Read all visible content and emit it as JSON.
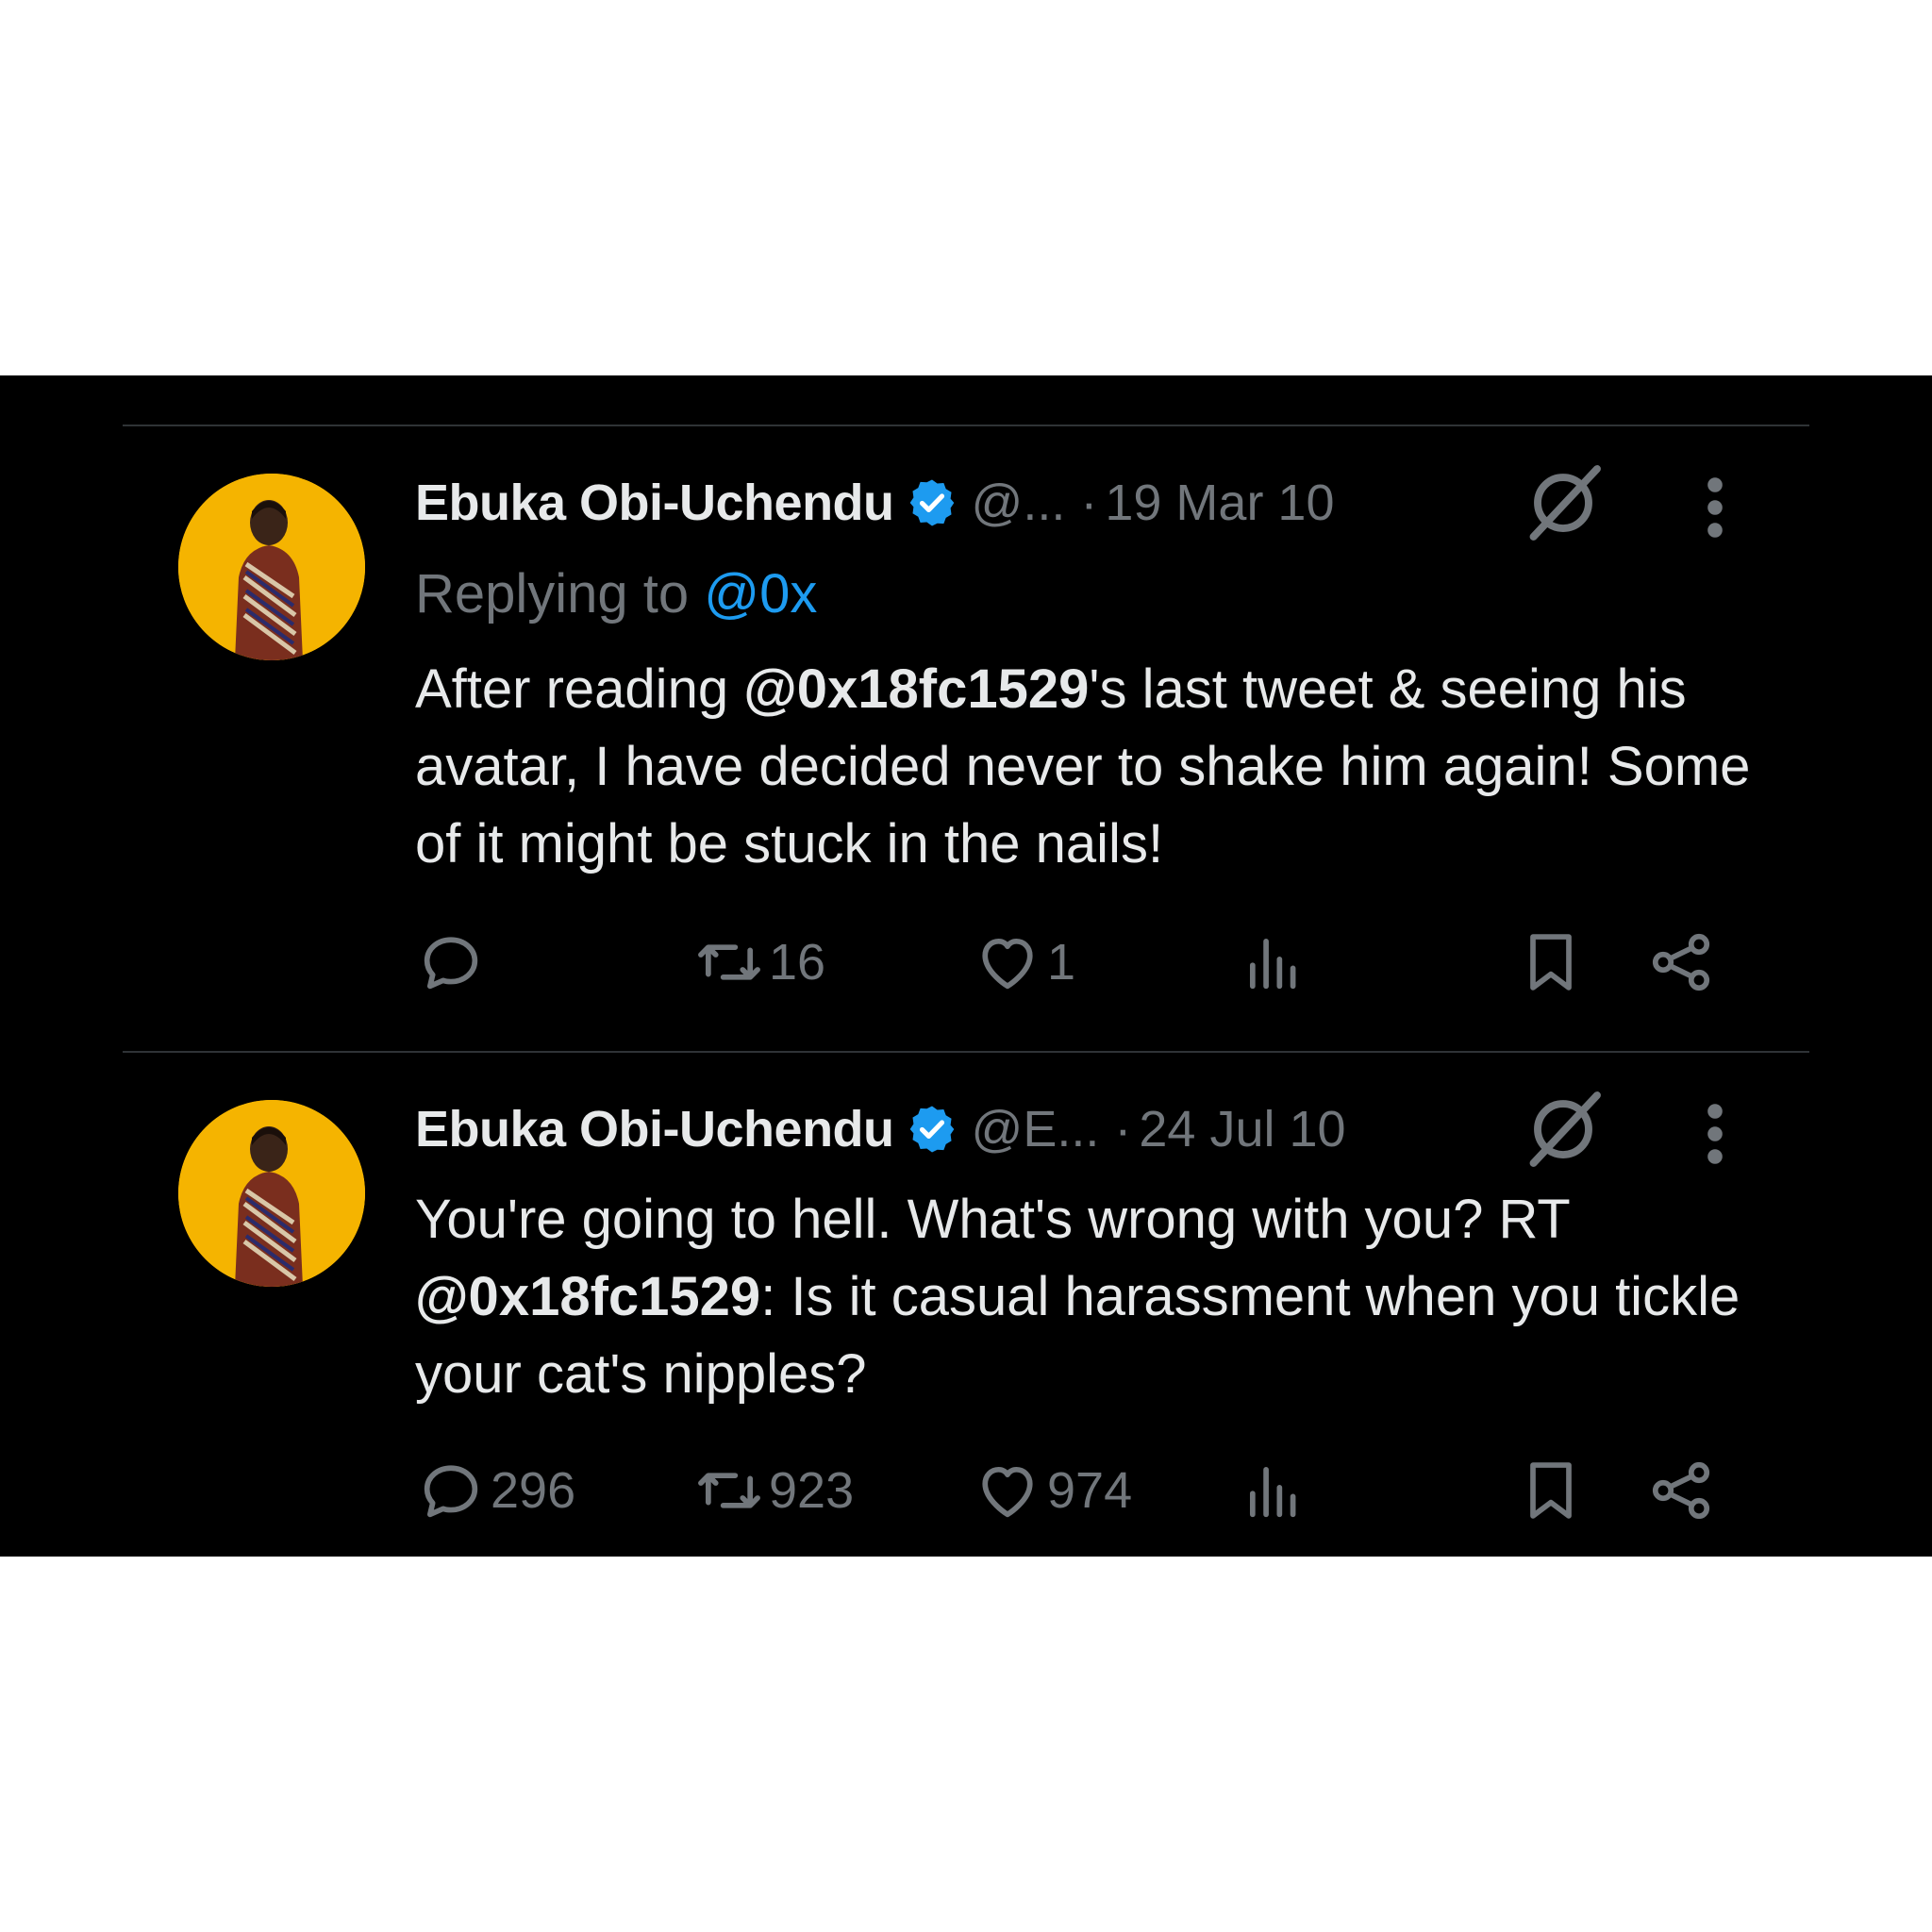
{
  "tweets": [
    {
      "author_name": "Ebuka Obi-Uchendu",
      "handle": "@...",
      "separator": "·",
      "date": "19 Mar 10",
      "replying_label": "Replying to",
      "replying_handle": "@0x",
      "body": {
        "pre": "After reading ",
        "mention": "@0x18fc1529",
        "post": "'s last tweet & seeing his avatar, I have decided never to shake him again! Some of it might be stuck in the nails!"
      },
      "stats": {
        "replies": "",
        "reposts": "16",
        "likes": "1"
      }
    },
    {
      "author_name": "Ebuka Obi-Uchendu",
      "handle": "@E...",
      "separator": "·",
      "date": "24 Jul 10",
      "body": {
        "pre": "You're going to hell. What's wrong with you? RT ",
        "mention": "@0x18fc1529",
        "post": ": Is it casual harassment when you tickle your cat's nipples?"
      },
      "stats": {
        "replies": "296",
        "reposts": "923",
        "likes": "974"
      }
    }
  ],
  "icons": {
    "verified": "verified-badge-icon",
    "grok": "grok-icon",
    "more": "more-icon",
    "reply": "reply-icon",
    "repost": "repost-icon",
    "like": "like-icon",
    "views": "views-icon",
    "bookmark": "bookmark-icon",
    "share": "share-icon"
  },
  "colors": {
    "background": "#000000",
    "text": "#e7e9ea",
    "muted": "#71767b",
    "link": "#1d9bf0",
    "verified": "#1d9bf0",
    "avatar_bg": "#f5b400"
  }
}
